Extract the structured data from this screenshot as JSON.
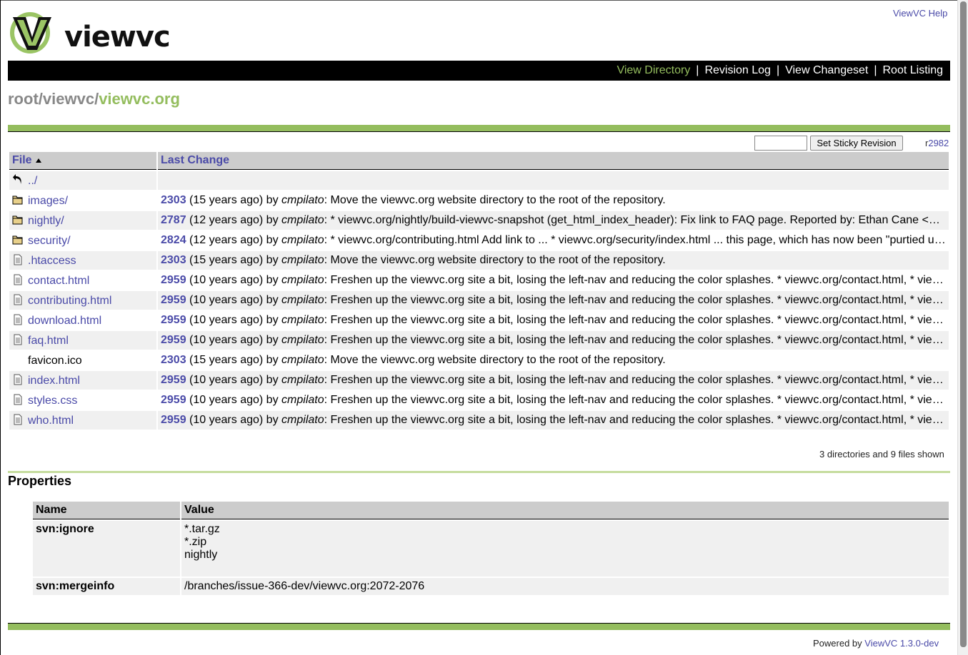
{
  "header": {
    "help_link": "ViewVC Help",
    "logo_text": "viewvc"
  },
  "nav": {
    "view_directory": "View Directory",
    "revision_log": "Revision Log",
    "view_changeset": "View Changeset",
    "root_listing": "Root Listing",
    "separator": "|"
  },
  "breadcrumb": {
    "root": "root",
    "dir": "viewvc",
    "current": "viewvc.org",
    "slash": "/"
  },
  "sticky": {
    "button_label": "Set Sticky Revision",
    "rev_prefix": "r",
    "rev_number": "2982"
  },
  "table": {
    "col_file": "File",
    "col_last_change": "Last Change",
    "parent_dir": "../",
    "rows": [
      {
        "name": "images/",
        "type": "dir",
        "rev": "2303",
        "age": "(15 years ago)",
        "by": "by",
        "author": "cmpilato",
        "log": ": Move the viewvc.org website directory to the root of the repository."
      },
      {
        "name": "nightly/",
        "type": "dir",
        "rev": "2787",
        "age": "(12 years ago)",
        "by": "by",
        "author": "cmpilato",
        "log": ": * viewvc.org/nightly/build-viewvc-snapshot (get_html_index_header): Fix link to FAQ page. Reported by: Ethan Cane <e…"
      },
      {
        "name": "security/",
        "type": "dir",
        "rev": "2824",
        "age": "(12 years ago)",
        "by": "by",
        "author": "cmpilato",
        "log": ": * viewvc.org/contributing.html Add link to ... * viewvc.org/security/index.html ... this page, which has now been \"purtied u…"
      },
      {
        "name": ".htaccess",
        "type": "file",
        "rev": "2303",
        "age": "(15 years ago)",
        "by": "by",
        "author": "cmpilato",
        "log": ": Move the viewvc.org website directory to the root of the repository."
      },
      {
        "name": "contact.html",
        "type": "file",
        "rev": "2959",
        "age": "(10 years ago)",
        "by": "by",
        "author": "cmpilato",
        "log": ": Freshen up the viewvc.org site a bit, losing the left-nav and reducing the color splashes. * viewvc.org/contact.html, * vie…"
      },
      {
        "name": "contributing.html",
        "type": "file",
        "rev": "2959",
        "age": "(10 years ago)",
        "by": "by",
        "author": "cmpilato",
        "log": ": Freshen up the viewvc.org site a bit, losing the left-nav and reducing the color splashes. * viewvc.org/contact.html, * vie…"
      },
      {
        "name": "download.html",
        "type": "file",
        "rev": "2959",
        "age": "(10 years ago)",
        "by": "by",
        "author": "cmpilato",
        "log": ": Freshen up the viewvc.org site a bit, losing the left-nav and reducing the color splashes. * viewvc.org/contact.html, * vie…"
      },
      {
        "name": "faq.html",
        "type": "file",
        "rev": "2959",
        "age": "(10 years ago)",
        "by": "by",
        "author": "cmpilato",
        "log": ": Freshen up the viewvc.org site a bit, losing the left-nav and reducing the color splashes. * viewvc.org/contact.html, * vie…"
      },
      {
        "name": "favicon.ico",
        "type": "binary",
        "rev": "2303",
        "age": "(15 years ago)",
        "by": "by",
        "author": "cmpilato",
        "log": ": Move the viewvc.org website directory to the root of the repository."
      },
      {
        "name": "index.html",
        "type": "file",
        "rev": "2959",
        "age": "(10 years ago)",
        "by": "by",
        "author": "cmpilato",
        "log": ": Freshen up the viewvc.org site a bit, losing the left-nav and reducing the color splashes. * viewvc.org/contact.html, * vie…"
      },
      {
        "name": "styles.css",
        "type": "file",
        "rev": "2959",
        "age": "(10 years ago)",
        "by": "by",
        "author": "cmpilato",
        "log": ": Freshen up the viewvc.org site a bit, losing the left-nav and reducing the color splashes. * viewvc.org/contact.html, * vie…"
      },
      {
        "name": "who.html",
        "type": "file",
        "rev": "2959",
        "age": "(10 years ago)",
        "by": "by",
        "author": "cmpilato",
        "log": ": Freshen up the viewvc.org site a bit, losing the left-nav and reducing the color splashes. * viewvc.org/contact.html, * vie…"
      }
    ],
    "summary": "3 directories and 9 files shown"
  },
  "properties": {
    "title": "Properties",
    "col_name": "Name",
    "col_value": "Value",
    "rows": [
      {
        "name": "svn:ignore",
        "values": [
          "*.tar.gz",
          "*.zip",
          "nightly"
        ]
      },
      {
        "name": "svn:mergeinfo",
        "values": [
          "/branches/issue-366-dev/viewvc.org:2072-2076"
        ]
      }
    ]
  },
  "footer": {
    "powered_by": "Powered by",
    "viewvc_link": "ViewVC 1.3.0-dev"
  },
  "colors": {
    "accent_green": "#94bd5e",
    "link_blue": "#4a4aa8",
    "nav_bg": "#000000",
    "header_cell": "#cccccc",
    "row_alt": "#f0f0f0"
  },
  "icons": {
    "parent": "back-arrow-icon",
    "dir": "folder-icon",
    "file": "text-file-icon"
  }
}
